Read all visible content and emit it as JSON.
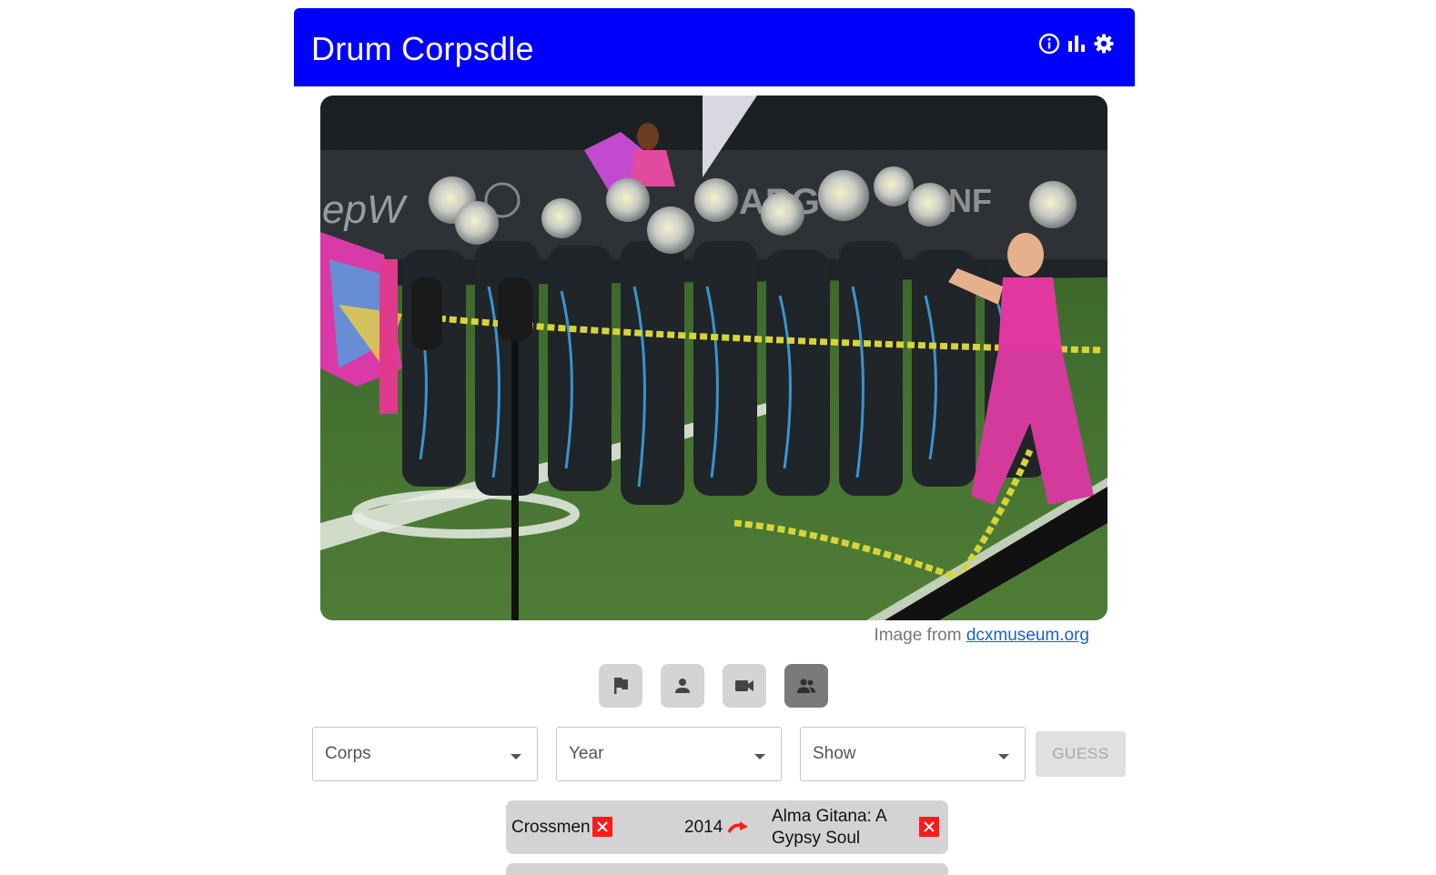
{
  "header": {
    "title": "Drum Corpsdle",
    "icons": [
      "info-icon",
      "stats-icon",
      "settings-icon"
    ],
    "background": "#0000ff"
  },
  "photo": {
    "caption_prefix": "Image from",
    "caption_link": "dcxmuseum.org"
  },
  "hints": [
    {
      "name": "flag-icon",
      "active": false
    },
    {
      "name": "person-icon",
      "active": false
    },
    {
      "name": "video-camera-icon",
      "active": false
    },
    {
      "name": "group-icon",
      "active": true
    }
  ],
  "form": {
    "corps_label": "Corps",
    "year_label": "Year",
    "show_label": "Show",
    "guess_button": "GUESS"
  },
  "guesses": [
    {
      "corps": "Crossmen",
      "corps_correct": false,
      "year": "2014",
      "year_hint": "arrow-later-icon",
      "show_line1": "Alma Gitana: A",
      "show_line2": "Gypsy Soul",
      "show_correct": false
    }
  ],
  "colors": {
    "incorrect": "#ff1a1a",
    "guess_row_bg": "#d3d3d3",
    "link": "#1a5fd0"
  }
}
